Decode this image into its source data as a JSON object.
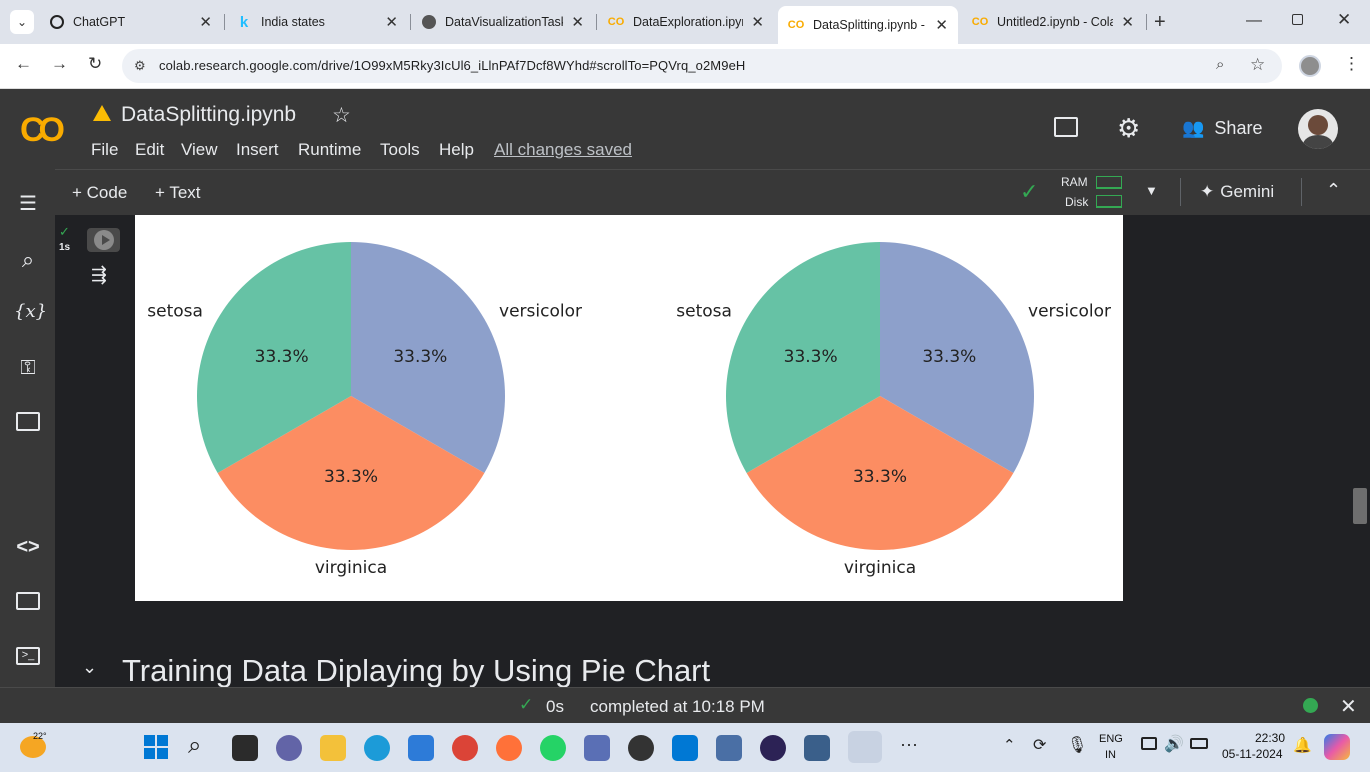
{
  "browser": {
    "tabs": [
      {
        "title": "ChatGPT",
        "icon": "chatgpt-icon"
      },
      {
        "title": "India states",
        "icon": "kaggle-icon"
      },
      {
        "title": "DataVisualizationTask",
        "icon": "github-icon"
      },
      {
        "title": "DataExploration.ipynb",
        "icon": "colab-icon"
      },
      {
        "title": "DataSplitting.ipynb -",
        "icon": "colab-icon",
        "active": true
      },
      {
        "title": "Untitled2.ipynb - Cola",
        "icon": "colab-icon"
      }
    ],
    "new_tab": "+",
    "url": "colab.research.google.com/drive/1O99xM5Rky3IcUl6_iLlnPAf7Dcf8WYhd#scrollTo=PQVrq_o2M9eH"
  },
  "colab": {
    "logo": "CO",
    "notebook_title": "DataSplitting.ipynb",
    "menus": [
      "File",
      "Edit",
      "View",
      "Insert",
      "Runtime",
      "Tools",
      "Help"
    ],
    "saved_status": "All changes saved",
    "share_label": "Share",
    "add_code": "+ Code",
    "add_text": "+ Text",
    "ram_label": "RAM",
    "disk_label": "Disk",
    "gemini_label": "Gemini",
    "exec_time": "1s",
    "section_heading": "Training Data Diplaying by Using Pie Chart",
    "status_time": "0s",
    "status_text": "completed at 10:18 PM"
  },
  "chart_data": [
    {
      "type": "pie",
      "categories": [
        "versicolor",
        "virginica",
        "setosa"
      ],
      "values": [
        33.3,
        33.3,
        33.3
      ],
      "labels": [
        "33.3%",
        "33.3%",
        "33.3%"
      ],
      "colors": [
        "#8da0cb",
        "#fc8d62",
        "#66c2a5"
      ]
    },
    {
      "type": "pie",
      "categories": [
        "versicolor",
        "virginica",
        "setosa"
      ],
      "values": [
        33.3,
        33.3,
        33.3
      ],
      "labels": [
        "33.3%",
        "33.3%",
        "33.3%"
      ],
      "colors": [
        "#8da0cb",
        "#fc8d62",
        "#66c2a5"
      ]
    }
  ],
  "taskbar": {
    "weather": "22°",
    "lang_top": "ENG",
    "lang_bottom": "IN",
    "time": "22:30",
    "date": "05-11-2024"
  }
}
